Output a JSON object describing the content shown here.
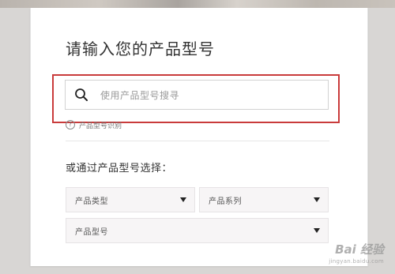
{
  "page": {
    "title": "请输入您的产品型号"
  },
  "search": {
    "placeholder": "使用产品型号搜寻"
  },
  "help": {
    "identify_label": "产品型号识别",
    "identify_icon": "?"
  },
  "selector": {
    "label": "或通过产品型号选择：",
    "dropdowns": [
      {
        "label": "产品类型"
      },
      {
        "label": "产品系列"
      },
      {
        "label": "产品型号"
      }
    ]
  },
  "watermark": {
    "logo": "Bai 经验",
    "sub": "jingyan.baidu.com"
  },
  "colors": {
    "highlight": "#c93b3b",
    "text": "#333333",
    "dropdown_bg": "#f7f5f6"
  },
  "icons": {
    "search": "search-icon",
    "dropdown": "chevron-down-icon",
    "help": "question-icon"
  }
}
